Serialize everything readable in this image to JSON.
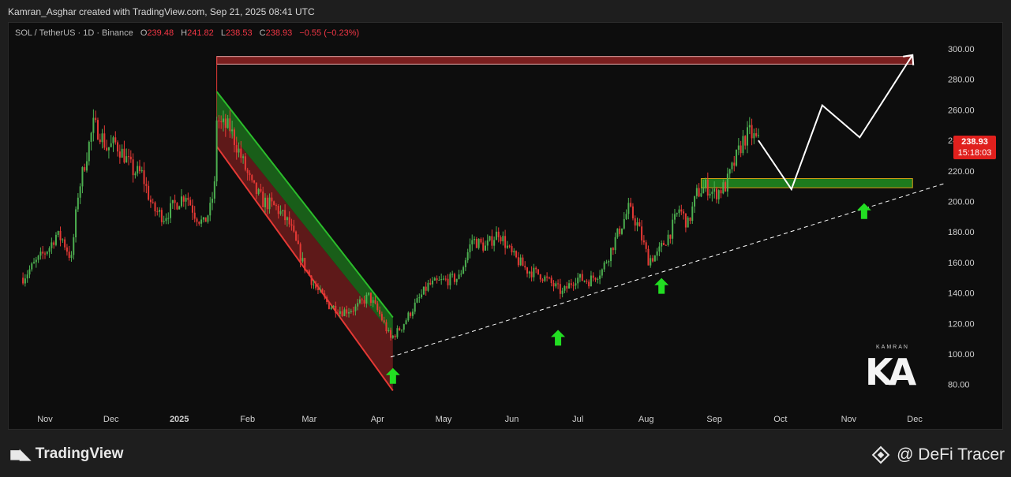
{
  "header": {
    "credit_line": "Kamran_Asghar created with TradingView.com, Sep 21, 2025 08:41 UTC"
  },
  "legend": {
    "symbol": "SOL / TetherUS · 1D · Binance",
    "o_label": "O",
    "o_value": "239.48",
    "h_label": "H",
    "h_value": "241.82",
    "l_label": "L",
    "l_value": "238.53",
    "c_label": "C",
    "c_value": "238.93",
    "change": "−0.55 (−0.23%)"
  },
  "price_tag": {
    "price": "238.93",
    "countdown": "15:18:03"
  },
  "footer": {
    "brand": "TradingView",
    "credit": "@ DeFi Tracer"
  },
  "watermark": {
    "name": "KAMRAN",
    "letters": "KA"
  },
  "colors": {
    "up": "#4caf50",
    "down": "#e53935",
    "channel_green": "#2bbd2b",
    "channel_red": "#e53935",
    "zone_red": "#7a1e1e",
    "zone_green": "#1d7a1d",
    "zone_border": "#d4a017",
    "arrow": "#22dd22",
    "path": "#ffffff"
  },
  "chart_data": {
    "type": "candlestick",
    "x_ticks": [
      "Nov",
      "Dec",
      "2025",
      "Feb",
      "Mar",
      "Apr",
      "May",
      "Jun",
      "Jul",
      "Aug",
      "Sep",
      "Oct",
      "Nov",
      "Dec"
    ],
    "y_ticks": [
      "300.00",
      "280.00",
      "260.00",
      "240.00",
      "220.00",
      "200.00",
      "180.00",
      "160.00",
      "140.00",
      "120.00",
      "100.00",
      "80.00"
    ],
    "ylim": [
      70,
      310
    ],
    "last_price": 238.93,
    "price_path": [
      [
        "2024-10-22",
        150
      ],
      [
        "2024-10-29",
        162
      ],
      [
        "2024-11-03",
        170
      ],
      [
        "2024-11-06",
        178
      ],
      [
        "2024-11-09",
        175
      ],
      [
        "2024-11-13",
        162
      ],
      [
        "2024-11-16",
        205
      ],
      [
        "2024-11-19",
        225
      ],
      [
        "2024-11-23",
        250
      ],
      [
        "2024-11-26",
        245
      ],
      [
        "2024-11-29",
        235
      ],
      [
        "2024-12-03",
        238
      ],
      [
        "2024-12-07",
        230
      ],
      [
        "2024-12-11",
        220
      ],
      [
        "2024-12-15",
        218
      ],
      [
        "2024-12-20",
        195
      ],
      [
        "2024-12-25",
        190
      ],
      [
        "2024-12-30",
        198
      ],
      [
        "2025-01-04",
        205
      ],
      [
        "2025-01-08",
        192
      ],
      [
        "2025-01-12",
        185
      ],
      [
        "2025-01-15",
        195
      ],
      [
        "2025-01-17",
        210
      ],
      [
        "2025-01-18",
        255
      ],
      [
        "2025-01-20",
        250
      ],
      [
        "2025-01-24",
        248
      ],
      [
        "2025-01-28",
        233
      ],
      [
        "2025-02-03",
        210
      ],
      [
        "2025-02-08",
        200
      ],
      [
        "2025-02-14",
        196
      ],
      [
        "2025-02-20",
        185
      ],
      [
        "2025-02-26",
        160
      ],
      [
        "2025-03-04",
        143
      ],
      [
        "2025-03-10",
        132
      ],
      [
        "2025-03-16",
        128
      ],
      [
        "2025-03-22",
        130
      ],
      [
        "2025-03-28",
        138
      ],
      [
        "2025-04-02",
        126
      ],
      [
        "2025-04-07",
        110
      ],
      [
        "2025-04-12",
        118
      ],
      [
        "2025-04-18",
        132
      ],
      [
        "2025-04-24",
        145
      ],
      [
        "2025-05-01",
        148
      ],
      [
        "2025-05-08",
        150
      ],
      [
        "2025-05-14",
        175
      ],
      [
        "2025-05-20",
        170
      ],
      [
        "2025-05-26",
        180
      ],
      [
        "2025-06-01",
        165
      ],
      [
        "2025-06-08",
        155
      ],
      [
        "2025-06-14",
        152
      ],
      [
        "2025-06-20",
        145
      ],
      [
        "2025-06-24",
        140
      ],
      [
        "2025-06-30",
        150
      ],
      [
        "2025-07-06",
        148
      ],
      [
        "2025-07-12",
        155
      ],
      [
        "2025-07-18",
        175
      ],
      [
        "2025-07-24",
        195
      ],
      [
        "2025-07-28",
        185
      ],
      [
        "2025-08-02",
        162
      ],
      [
        "2025-08-06",
        165
      ],
      [
        "2025-08-12",
        180
      ],
      [
        "2025-08-16",
        195
      ],
      [
        "2025-08-20",
        185
      ],
      [
        "2025-08-24",
        205
      ],
      [
        "2025-08-28",
        210
      ],
      [
        "2025-09-01",
        205
      ],
      [
        "2025-09-06",
        210
      ],
      [
        "2025-09-10",
        225
      ],
      [
        "2025-09-14",
        240
      ],
      [
        "2025-09-17",
        245
      ],
      [
        "2025-09-21",
        238.93
      ]
    ],
    "descending_channel": {
      "upper": [
        [
          "2025-01-18",
          272
        ],
        [
          "2025-04-08",
          124
        ]
      ],
      "lower": [
        [
          "2025-01-18",
          236
        ],
        [
          "2025-04-08",
          76
        ]
      ]
    },
    "ascending_trendline": [
      [
        "2025-04-07",
        98
      ],
      [
        "2025-12-15",
        212
      ]
    ],
    "target_zone": {
      "start": "2025-01-18",
      "end": "2025-11-30",
      "low": 290,
      "high": 295
    },
    "support_zone": {
      "start": "2025-08-26",
      "end": "2025-11-30",
      "low": 209,
      "high": 215
    },
    "projection_path": [
      [
        "2025-09-21",
        240
      ],
      [
        "2025-10-06",
        208
      ],
      [
        "2025-10-20",
        263
      ],
      [
        "2025-11-06",
        242
      ],
      [
        "2025-11-30",
        296
      ]
    ],
    "up_arrows": [
      [
        "2025-04-08",
        96
      ],
      [
        "2025-06-22",
        121
      ],
      [
        "2025-08-08",
        155
      ],
      [
        "2025-11-08",
        204
      ]
    ]
  }
}
